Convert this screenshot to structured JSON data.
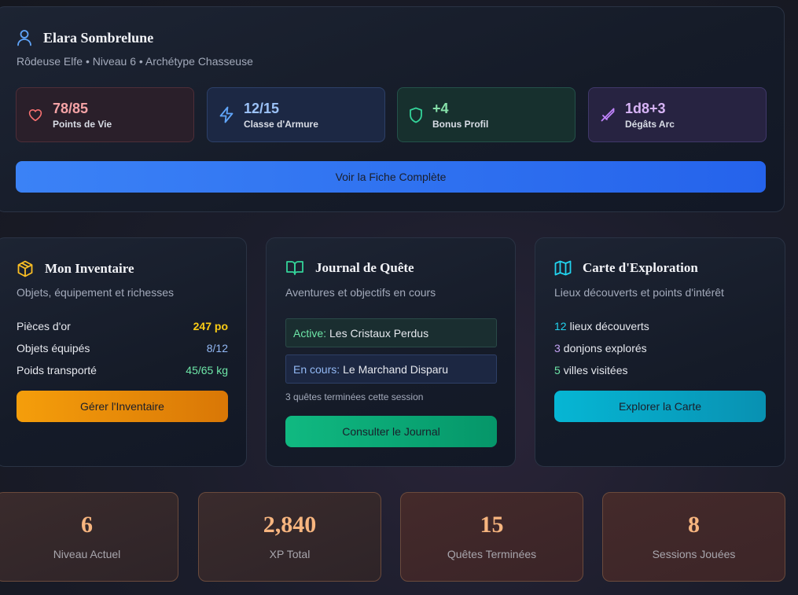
{
  "character": {
    "name": "Elara Sombrelune",
    "subtitle": "Rôdeuse Elfe • Niveau 6 • Archétype Chasseuse",
    "stats": [
      {
        "value": "78/85",
        "label": "Points de Vie",
        "icon": "heart-icon"
      },
      {
        "value": "12/15",
        "label": "Classe d'Armure",
        "icon": "lightning-icon"
      },
      {
        "value": "+4",
        "label": "Bonus Profil",
        "icon": "shield-icon"
      },
      {
        "value": "1d8+3",
        "label": "Dégâts Arc",
        "icon": "sword-icon"
      }
    ],
    "button_label": "Voir la Fiche Complète"
  },
  "inventory": {
    "title": "Mon Inventaire",
    "subtitle": "Objets, équipement et richesses",
    "icon": "box-icon",
    "rows": [
      {
        "label": "Pièces d'or",
        "value": "247 po",
        "color": "#facc15"
      },
      {
        "label": "Objets équipés",
        "value": "8/12",
        "color": "#93b9f5"
      },
      {
        "label": "Poids transporté",
        "value": "45/65 kg",
        "color": "#6ee7a8"
      }
    ],
    "button_label": "Gérer l'Inventaire"
  },
  "quests": {
    "title": "Journal de Quête",
    "subtitle": "Aventures et objectifs en cours",
    "icon": "book-icon",
    "active_key": "Active:",
    "active_value": "Les Cristaux Perdus",
    "progress_key": "En cours:",
    "progress_value": "Le Marchand Disparu",
    "note": "3 quêtes terminées cette session",
    "button_label": "Consulter le Journal"
  },
  "map": {
    "title": "Carte d'Exploration",
    "subtitle": "Lieux découverts et points d'intérêt",
    "icon": "map-icon",
    "lines": [
      {
        "num": "12",
        "text": "lieux découverts",
        "color": "#22d3ee"
      },
      {
        "num": "3",
        "text": "donjons explorés",
        "color": "#c4a3f5"
      },
      {
        "num": "5",
        "text": "villes visitées",
        "color": "#6ee7a8"
      }
    ],
    "button_label": "Explorer la Carte"
  },
  "summary": [
    {
      "value": "6",
      "label": "Niveau Actuel"
    },
    {
      "value": "2,840",
      "label": "XP Total"
    },
    {
      "value": "15",
      "label": "Quêtes Terminées"
    },
    {
      "value": "8",
      "label": "Sessions Jouées"
    }
  ]
}
